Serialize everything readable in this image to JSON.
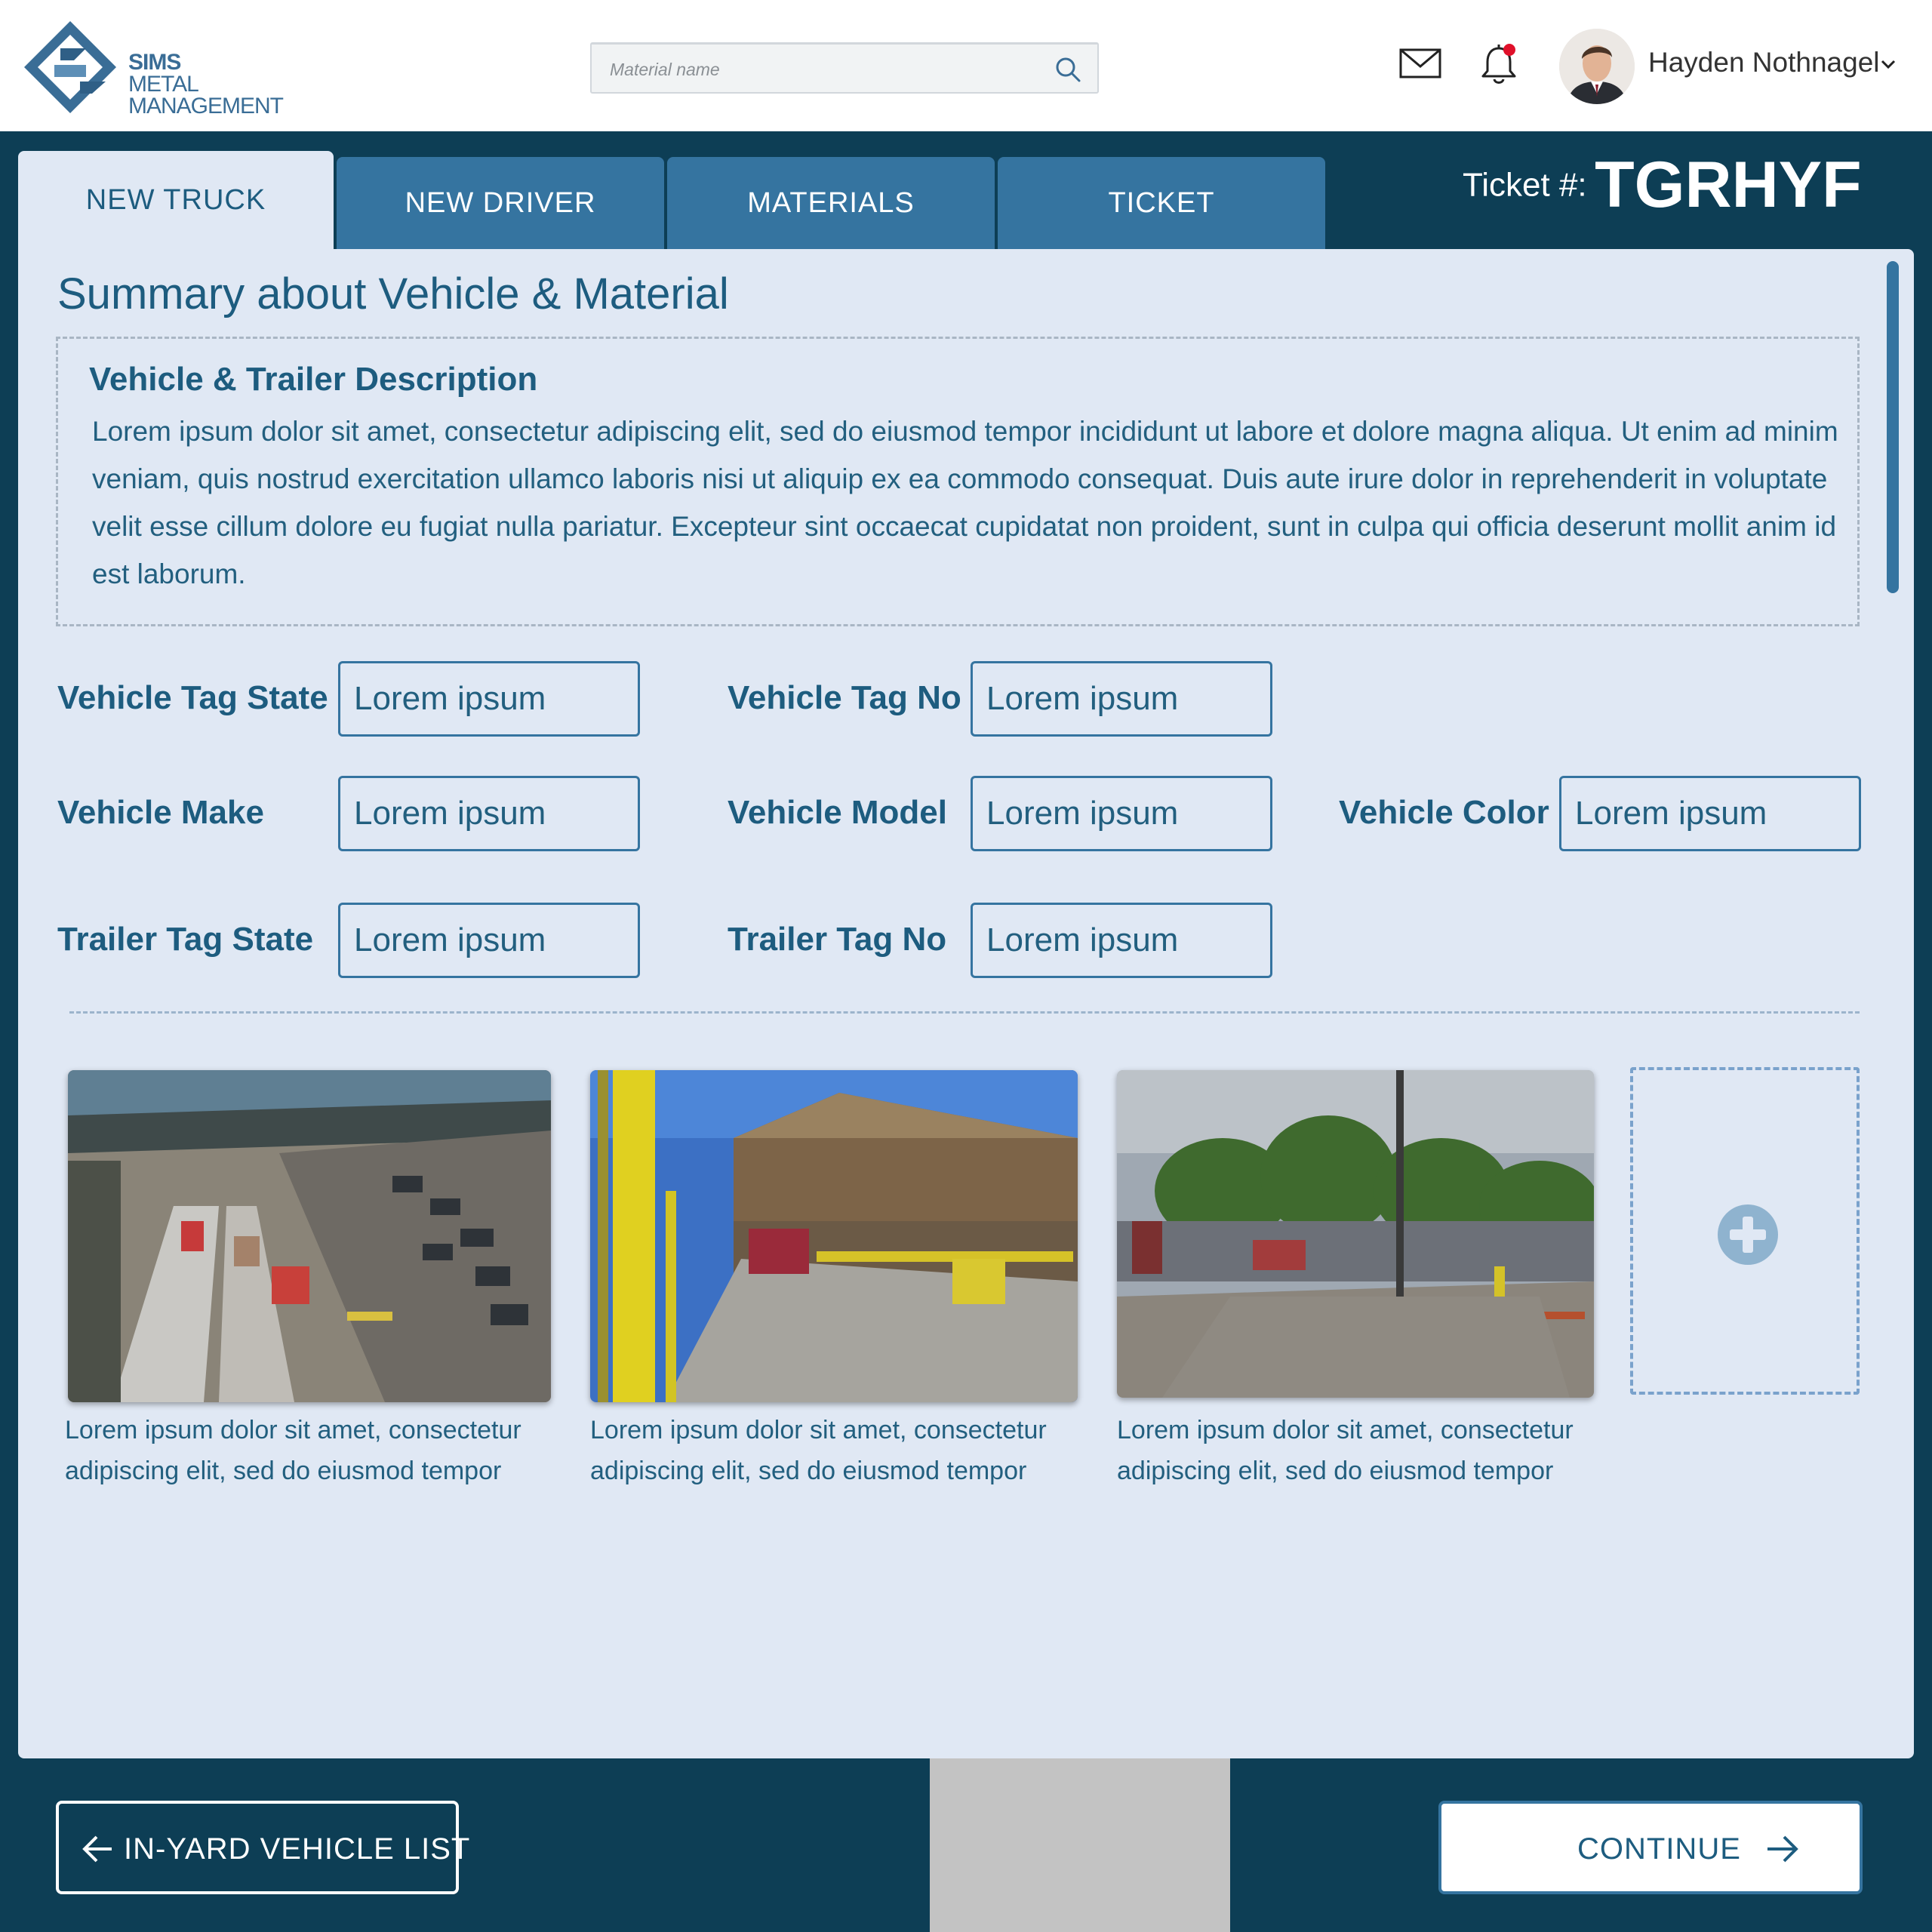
{
  "app": {
    "logo": {
      "line1": "SIMS",
      "line2": "METAL",
      "line3": "MANAGEMENT"
    },
    "search": {
      "placeholder": "Material name",
      "icon": "search-icon"
    },
    "icons": {
      "mail": "mail-icon",
      "notifications": "bell-icon"
    },
    "user": {
      "name": "Hayden Nothnagel"
    },
    "colors": {
      "navy": "#0d3e55",
      "tab_blue": "#3574a0",
      "panel": "#e0e8f4",
      "text_blue": "#1d5c7f",
      "alert_red": "#e0102a"
    }
  },
  "tabs": [
    {
      "label": "NEW TRUCK",
      "active": true
    },
    {
      "label": "NEW DRIVER",
      "active": false
    },
    {
      "label": "MATERIALS",
      "active": false
    },
    {
      "label": "TICKET",
      "active": false
    }
  ],
  "ticket": {
    "label": "Ticket #:",
    "value": "TGRHYF"
  },
  "summary": {
    "title": "Summary about Vehicle & Material",
    "description_title": "Vehicle & Trailer Description",
    "description_text": "Lorem ipsum dolor sit amet, consectetur adipiscing elit, sed do eiusmod tempor incididunt ut labore et dolore magna aliqua. Ut enim ad minim veniam, quis nostrud exercitation ullamco laboris nisi ut aliquip ex ea commodo consequat. Duis aute irure dolor in reprehenderit in voluptate velit esse cillum dolore eu fugiat nulla pariatur. Excepteur sint occaecat cupidatat non proident, sunt in culpa qui officia deserunt mollit anim id est laborum."
  },
  "fields": {
    "vehicle_tag_state": {
      "label": "Vehicle Tag State",
      "value": "Lorem ipsum"
    },
    "vehicle_tag_no": {
      "label": "Vehicle Tag No",
      "value": "Lorem ipsum"
    },
    "vehicle_make": {
      "label": "Vehicle Make",
      "value": "Lorem ipsum"
    },
    "vehicle_model": {
      "label": "Vehicle Model",
      "value": "Lorem ipsum"
    },
    "vehicle_color": {
      "label": "Vehicle Color",
      "value": "Lorem ipsum"
    },
    "trailer_tag_state": {
      "label": "Trailer Tag State",
      "value": "Lorem ipsum"
    },
    "trailer_tag_no": {
      "label": "Trailer Tag No",
      "value": "Lorem ipsum"
    }
  },
  "photos": [
    {
      "caption_line1": "Lorem ipsum dolor sit amet, consectetur",
      "caption_line2": "adipiscing elit, sed do eiusmod tempor"
    },
    {
      "caption_line1": "Lorem ipsum dolor sit amet, consectetur",
      "caption_line2": "adipiscing elit, sed do eiusmod tempor"
    },
    {
      "caption_line1": "Lorem ipsum dolor sit amet, consectetur",
      "caption_line2": "adipiscing elit, sed do eiusmod tempor"
    }
  ],
  "add_photo": {
    "icon": "plus-circle-icon"
  },
  "footer": {
    "back_label": "IN-YARD VEHICLE LIST",
    "continue_label": "CONTINUE"
  }
}
